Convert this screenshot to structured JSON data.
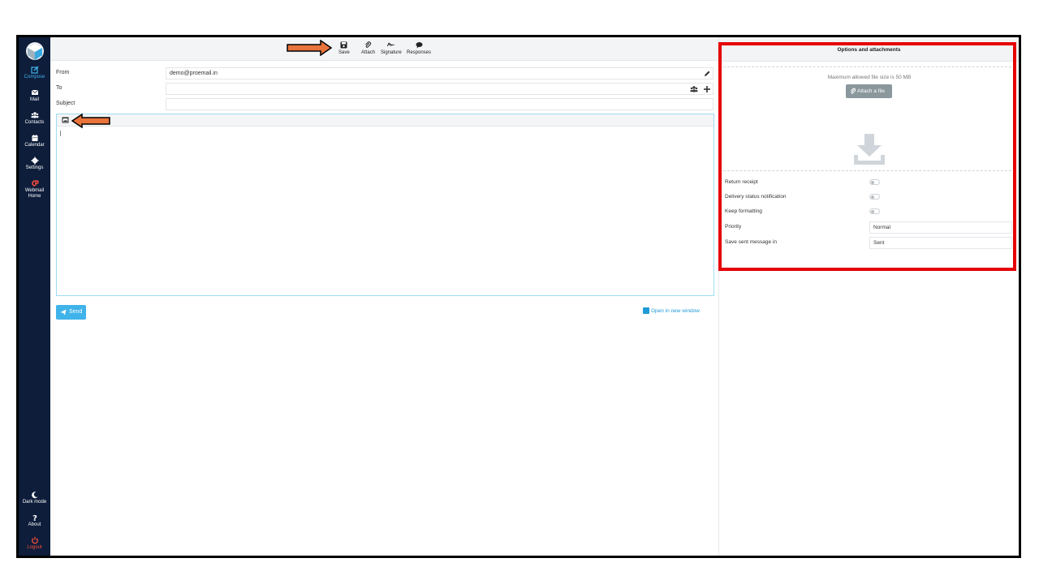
{
  "sidebar": {
    "items": [
      {
        "label": "Compose",
        "icon": "compose-icon"
      },
      {
        "label": "Mail",
        "icon": "envelope-icon"
      },
      {
        "label": "Contacts",
        "icon": "users-icon"
      },
      {
        "label": "Calendar",
        "icon": "calendar-icon"
      },
      {
        "label": "Settings",
        "icon": "gear-icon"
      },
      {
        "label": "Webmail Home",
        "icon": "cpanel-icon"
      }
    ],
    "bottom": [
      {
        "label": "Dark mode",
        "icon": "moon-icon"
      },
      {
        "label": "About",
        "icon": "question-icon"
      },
      {
        "label": "Logout",
        "icon": "power-icon"
      }
    ]
  },
  "toolbar": {
    "save": "Save",
    "attach": "Attach",
    "signature": "Signature",
    "responses": "Responses"
  },
  "form": {
    "from_label": "From",
    "from_value": "demo@proemail.in",
    "to_label": "To",
    "to_value": "",
    "subject_label": "Subject",
    "subject_value": ""
  },
  "actions": {
    "send": "Send",
    "open_new_window": "Open in new window"
  },
  "options": {
    "title": "Options and attachments",
    "max_size": "Maximum allowed file size is 50 MB",
    "attach_file": "Attach a file",
    "return_receipt": "Return receipt",
    "delivery_status": "Delivery status notification",
    "keep_formatting": "Keep formatting",
    "priority_label": "Priority",
    "priority_value": "Normal",
    "save_sent_label": "Save sent message in",
    "save_sent_value": "Sent"
  },
  "colors": {
    "sidebar_bg": "#0d1d3a",
    "accent": "#3fb3ea",
    "highlight_box": "#e60000",
    "arrow": "#e8743b"
  }
}
